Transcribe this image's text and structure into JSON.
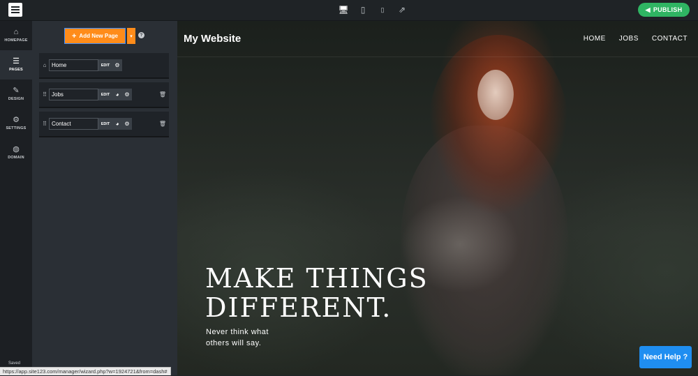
{
  "topbar": {
    "devices": [
      {
        "name": "desktop-icon",
        "glyph": "🖥"
      },
      {
        "name": "tablet-icon",
        "glyph": "▯"
      },
      {
        "name": "mobile-icon",
        "glyph": "▯"
      },
      {
        "name": "external-link-icon",
        "glyph": "⇗"
      }
    ],
    "publish_label": "PUBLISH",
    "publish_icon": "megaphone-icon"
  },
  "rail": {
    "items": [
      {
        "label": "HOMEPAGE",
        "icon": "⌂"
      },
      {
        "label": "PAGES",
        "icon": "☰"
      },
      {
        "label": "DESIGN",
        "icon": "✎"
      },
      {
        "label": "SETTINGS",
        "icon": "⚙"
      },
      {
        "label": "DOMAIN",
        "icon": "◍"
      }
    ],
    "saved": "Saved"
  },
  "panel": {
    "add_page_label": "Add New Page",
    "add_page_plus": "+",
    "caret": "▾",
    "help": "?",
    "pages": [
      {
        "name": "Home",
        "edit": "EDIT"
      },
      {
        "name": "Jobs",
        "edit": "EDIT"
      },
      {
        "name": "Contact",
        "edit": "EDIT"
      }
    ]
  },
  "preview": {
    "site_title": "My Website",
    "nav": [
      "HOME",
      "JOBS",
      "CONTACT"
    ],
    "hero_line1": "MAKE THINGS",
    "hero_line2": "DIFFERENT.",
    "hero_sub": "Never think what others will say.",
    "help_button": "Need Help ?"
  },
  "status_url": "https://app.site123.com/manager/wizard.php?w=1924721&from=dash#",
  "colors": {
    "publish": "#2fb563",
    "add_page": "#ff8c1a",
    "help_button": "#1f8ef1"
  }
}
